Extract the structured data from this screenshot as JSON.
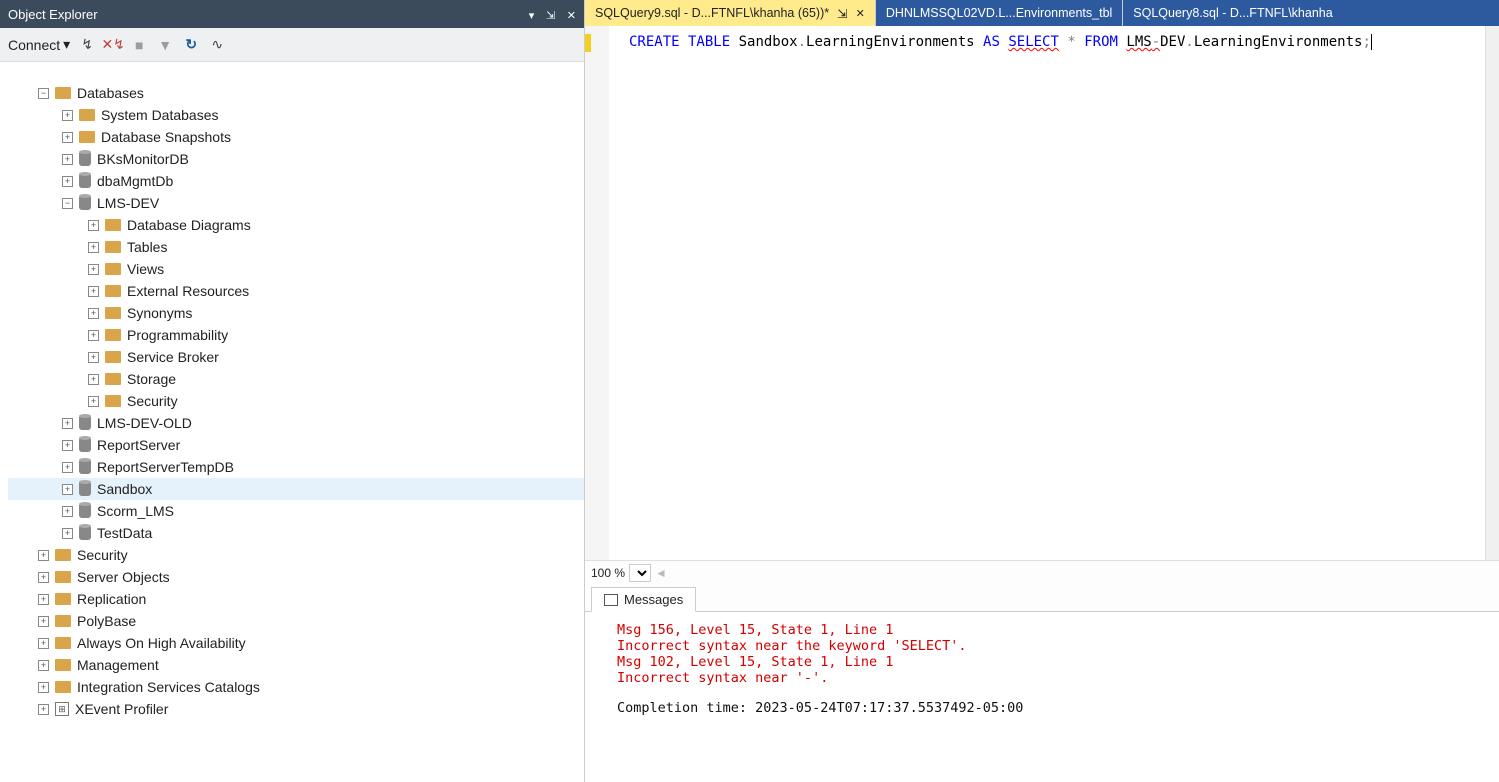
{
  "objectExplorer": {
    "title": "Object Explorer",
    "toolbar": {
      "connect": "Connect"
    },
    "tree": {
      "databases": {
        "label": "Databases",
        "children": {
          "system_databases": "System Databases",
          "db_snapshots": "Database Snapshots",
          "bksmonitor": "BKsMonitorDB",
          "dbamgmt": "dbaMgmtDb",
          "lmsdev": {
            "label": "LMS-DEV",
            "children": {
              "diagrams": "Database Diagrams",
              "tables": "Tables",
              "views": "Views",
              "external": "External Resources",
              "synonyms": "Synonyms",
              "programmability": "Programmability",
              "servicebroker": "Service Broker",
              "storage": "Storage",
              "security": "Security"
            }
          },
          "lmsdevold": "LMS-DEV-OLD",
          "reportserver": "ReportServer",
          "reportservertemp": "ReportServerTempDB",
          "sandbox": "Sandbox",
          "scorm": "Scorm_LMS",
          "testdata": "TestData"
        }
      },
      "security": "Security",
      "serverobjects": "Server Objects",
      "replication": "Replication",
      "polybase": "PolyBase",
      "alwayson": "Always On High Availability",
      "management": "Management",
      "isc": "Integration Services Catalogs",
      "xevent": "XEvent Profiler"
    }
  },
  "tabs": {
    "active": "SQLQuery9.sql - D...FTNFL\\khanha (65))*",
    "second": "DHNLMSSQL02VD.L...Environments_tbl",
    "third": "SQLQuery8.sql - D...FTNFL\\khanha"
  },
  "editor": {
    "code": {
      "create_table": "CREATE TABLE",
      "sandbox_obj": " Sandbox",
      "dot1": ".",
      "le1": "LearningEnvironments ",
      "as": "AS",
      "sp1": " ",
      "select": "SELECT",
      "sp2": " ",
      "star": "*",
      "sp3": " ",
      "from": "FROM",
      "sp4": " ",
      "lms": "LMS",
      "dash": "-",
      "dev": "DEV",
      "dot2": ".",
      "le2": "LearningEnvironments",
      "semi": ";"
    },
    "zoom": "100 %"
  },
  "messages": {
    "tab_label": "Messages",
    "lines": [
      "Msg 156, Level 15, State 1, Line 1",
      "Incorrect syntax near the keyword 'SELECT'.",
      "Msg 102, Level 15, State 1, Line 1",
      "Incorrect syntax near '-'."
    ],
    "completion": "Completion time: 2023-05-24T07:17:37.5537492-05:00"
  }
}
